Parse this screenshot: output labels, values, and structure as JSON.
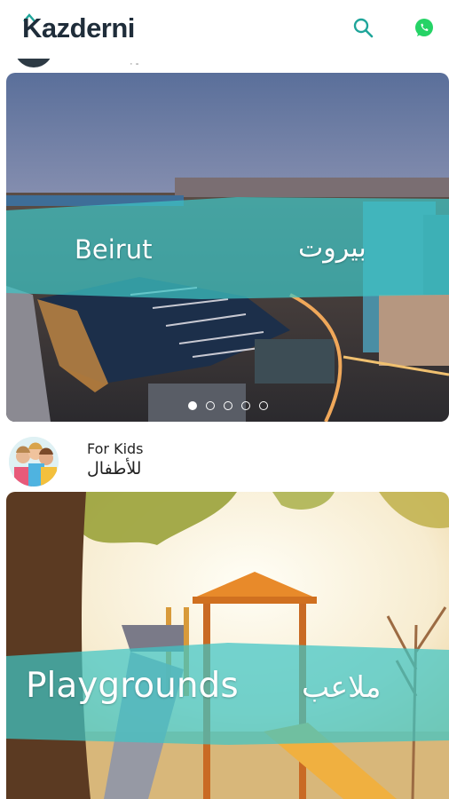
{
  "app": {
    "logo_text": "Kazderni"
  },
  "header": {
    "icons": [
      "search-icon",
      "whatsapp-icon"
    ],
    "accent": "#1fa59a",
    "whatsapp_color": "#25d366"
  },
  "featured": {
    "title_en": "Beirut",
    "title_ar": "بيروت",
    "carousel": {
      "count": 5,
      "active_index": 0
    }
  },
  "category": {
    "title_en": "For Kids",
    "title_ar": "للأطفال",
    "card": {
      "title_en": "Playgrounds",
      "title_ar": "ملاعب"
    }
  },
  "colors": {
    "banner_teal": "#3ec5c5",
    "brand_dark": "#1f2d3a"
  }
}
